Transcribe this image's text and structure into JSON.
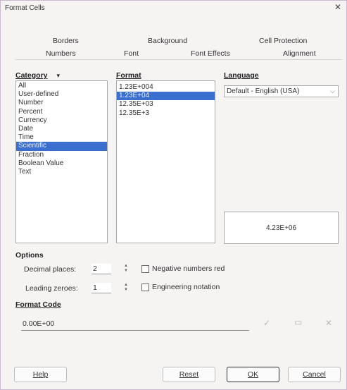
{
  "window": {
    "title": "Format Cells",
    "close_glyph": "✕"
  },
  "tabs": {
    "row1": [
      "Borders",
      "Background",
      "Cell Protection"
    ],
    "row2": [
      "Numbers",
      "Font",
      "Font Effects",
      "Alignment"
    ]
  },
  "category": {
    "label": "Category",
    "sort_glyph": "▾",
    "items": [
      "All",
      "User-defined",
      "Number",
      "Percent",
      "Currency",
      "Date",
      "Time",
      "Scientific",
      "Fraction",
      "Boolean Value",
      "Text"
    ],
    "selected": "Scientific"
  },
  "format": {
    "label": "Format",
    "items": [
      "1.23E+004",
      "1.23E+04",
      "12.35E+03",
      "12.35E+3"
    ],
    "selected": "1.23E+04"
  },
  "language": {
    "label": "Language",
    "value": "Default - English (USA)",
    "arrow_glyph": "⌵"
  },
  "preview": {
    "value": "4.23E+06"
  },
  "options": {
    "label": "Options",
    "decimal_places": {
      "label": "Decimal places:",
      "value": "2"
    },
    "leading_zeroes": {
      "label": "Leading zeroes:",
      "value": "1"
    },
    "negative_red": {
      "label": "Negative numbers red",
      "checked": false
    },
    "engineering": {
      "label": "Engineering notation",
      "checked": false
    }
  },
  "format_code": {
    "label": "Format Code",
    "value": "0.00E+00",
    "accept_glyph": "✓",
    "comment_glyph": "▭",
    "delete_glyph": "✕"
  },
  "buttons": {
    "help": "Help",
    "reset": "Reset",
    "ok": "OK",
    "cancel": "Cancel"
  }
}
